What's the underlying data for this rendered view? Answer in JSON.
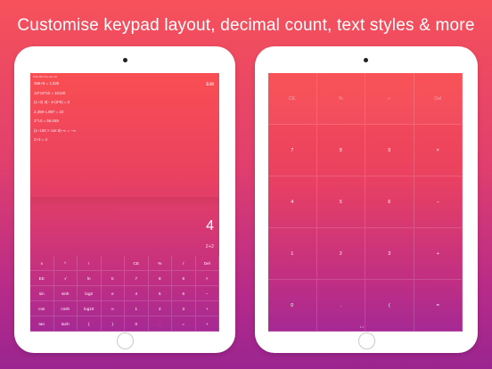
{
  "headline": "Customise keypad layout, decimal count, text styles & more",
  "left_screen": {
    "status_left": "9:41 AM   Tue Jan 10",
    "edit_label": "Edit",
    "history": [
      "365+5 = 1,825",
      "10*10*10 = 10100",
      "(1+2) 3(− 4-(6*8) = 0",
      "2,359-1,987 = 22",
      "3^10 = 59,049",
      "(1÷100 × cos 8)−∞ = −∞",
      "2+2 = 4"
    ],
    "display_value": "4",
    "display_expression": "2+2",
    "keys": [
      "x",
      "^",
      "!",
      "",
      "CE",
      "%",
      "/",
      "Del",
      "EE",
      "√",
      "ln",
      "π",
      "7",
      "8",
      "9",
      "×",
      "sin",
      "sinh",
      "log2",
      "e",
      "4",
      "5",
      "6",
      "−",
      "cos",
      "cosh",
      "log10",
      "∞",
      "1",
      "2",
      "3",
      "+",
      "tan",
      "tanh",
      "(",
      ")",
      "0",
      ".",
      "=",
      "+"
    ]
  },
  "right_screen": {
    "keys": [
      "CE",
      "%",
      "÷",
      "Del",
      "7",
      "8",
      "9",
      "×",
      "4",
      "5",
      "6",
      "−",
      "1",
      "2",
      "3",
      "+",
      "0",
      ".",
      "(",
      "="
    ],
    "page_dots": "• •"
  }
}
